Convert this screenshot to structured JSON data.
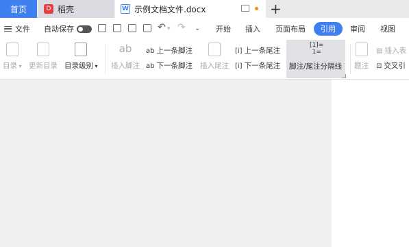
{
  "tabs": {
    "home": "首页",
    "daoke": "稻壳",
    "daoke_icon_text": "D",
    "doc": "示例文档文件.docx",
    "doc_icon_text": "W",
    "new_tab": "+"
  },
  "menu": {
    "file": "文件",
    "autosave": "自动保存",
    "ribbon_tabs": [
      "开始",
      "插入",
      "页面布局",
      "引用",
      "审阅",
      "视图"
    ],
    "active_tab": "引用"
  },
  "ribbon": {
    "toc": "目录",
    "update_toc": "更新目录",
    "toc_level": "目录级别",
    "insert_footnote": "插入脚注",
    "prev_footnote": "上一条脚注",
    "next_footnote": "下一条脚注",
    "insert_endnote": "插入尾注",
    "prev_endnote": "上一条尾注",
    "next_endnote": "下一条尾注",
    "footnote_sep": "脚注/尾注分隔线",
    "caption": "题注",
    "insert_table_caption": "插入表",
    "cross_ref": "交叉引",
    "footnote_icon_text": "ab",
    "footnote_sup": "1",
    "footnote_small": "ab",
    "endnote_icon_text": "[i]",
    "split_icon_text": "[1]=\n1="
  }
}
